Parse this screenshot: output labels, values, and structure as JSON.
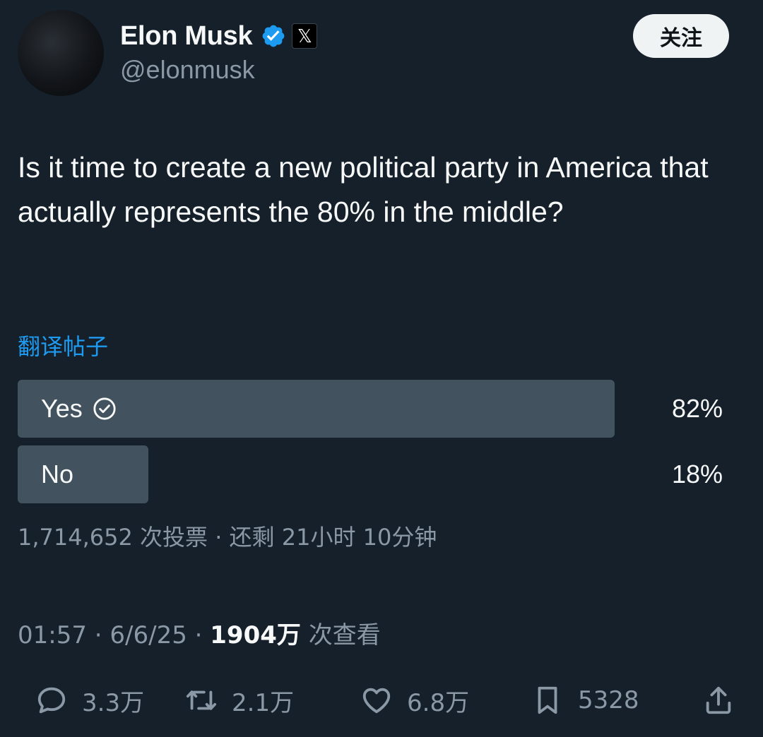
{
  "author": {
    "name": "Elon Musk",
    "handle": "@elonmusk"
  },
  "follow_button": "关注",
  "tweet_text": "Is it time to create a new political party in America that actually represents the 80% in the middle?",
  "translate_link": "翻译帖子",
  "poll": {
    "options": [
      {
        "label": "Yes",
        "percent": "82%",
        "fraction": 0.82,
        "winner": true
      },
      {
        "label": "No",
        "percent": "18%",
        "fraction": 0.18,
        "winner": false
      }
    ],
    "meta": "1,714,652 次投票 · 还剩 21小时 10分钟"
  },
  "timestamp": {
    "time": "01:57 · 6/6/25 · ",
    "views": "1904万",
    "views_label": " 次查看"
  },
  "actions": {
    "replies": "3.3万",
    "reposts": "2.1万",
    "likes": "6.8万",
    "bookmarks": "5328"
  },
  "colors": {
    "background": "#15202b",
    "accent": "#1d9bf0",
    "poll_bar": "#42535f",
    "muted_text": "#8b98a5"
  }
}
